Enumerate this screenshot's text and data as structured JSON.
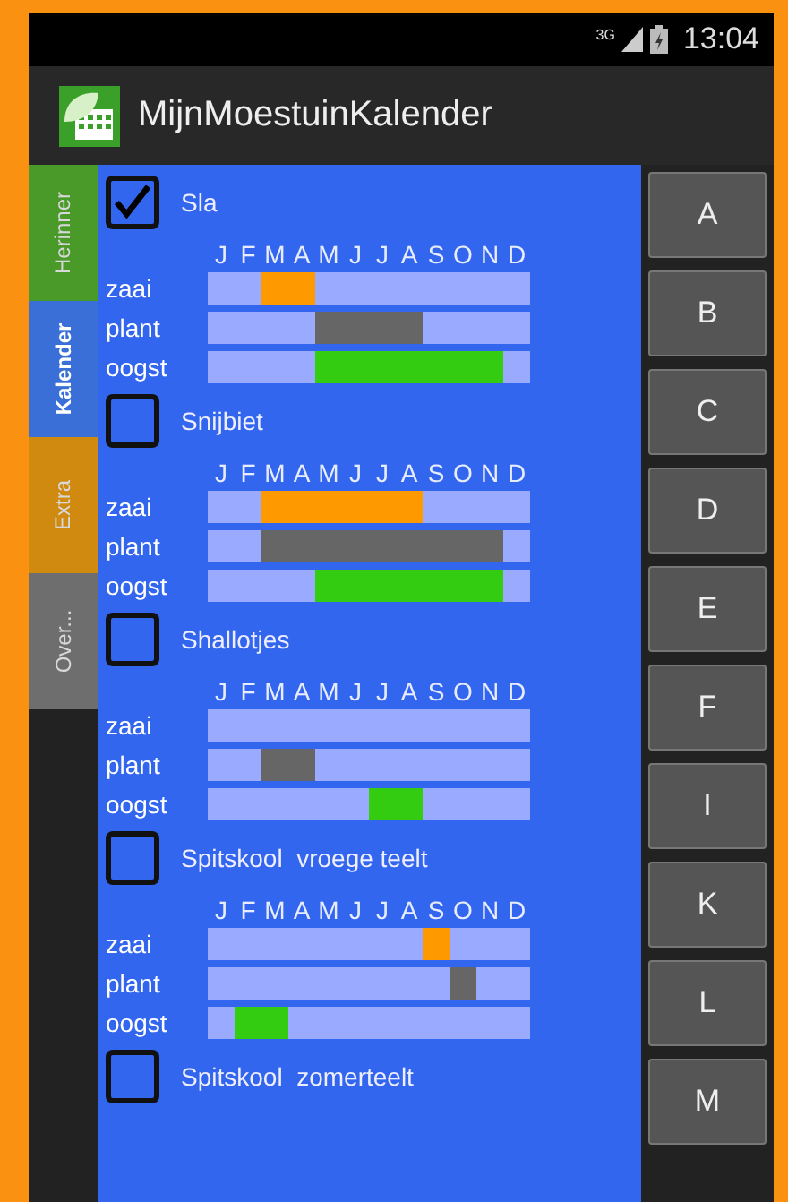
{
  "status_bar": {
    "network": "3G",
    "time": "13:04"
  },
  "app_bar": {
    "title": "MijnMoestuinKalender"
  },
  "side_tabs": [
    {
      "label": "Herinner",
      "selected": false,
      "color": "#4a9a2a"
    },
    {
      "label": "Kalender",
      "selected": true,
      "color": "#3a6fd8"
    },
    {
      "label": "Extra",
      "selected": false,
      "color": "#d08a10"
    },
    {
      "label": "Over...",
      "selected": false,
      "color": "#6e6e6e"
    }
  ],
  "crops": [
    {
      "name": "Sla",
      "checked": true,
      "months": [
        "J",
        "F",
        "M",
        "A",
        "M",
        "J",
        "J",
        "A",
        "S",
        "O",
        "N",
        "D"
      ],
      "rows": [
        {
          "label": "zaai",
          "active": [
            false,
            false,
            true,
            true,
            false,
            false,
            false,
            false,
            false,
            false,
            false,
            false
          ]
        },
        {
          "label": "plant",
          "active": [
            false,
            false,
            false,
            false,
            true,
            true,
            true,
            true,
            false,
            false,
            false,
            false
          ]
        },
        {
          "label": "oogst",
          "active": [
            false,
            false,
            false,
            false,
            true,
            true,
            true,
            true,
            true,
            true,
            true,
            false
          ]
        }
      ]
    },
    {
      "name": "Snijbiet",
      "checked": false,
      "months": [
        "J",
        "F",
        "M",
        "A",
        "M",
        "J",
        "J",
        "A",
        "S",
        "O",
        "N",
        "D"
      ],
      "rows": [
        {
          "label": "zaai",
          "active": [
            false,
            false,
            true,
            true,
            true,
            true,
            true,
            true,
            false,
            false,
            false,
            false
          ]
        },
        {
          "label": "plant",
          "active": [
            false,
            false,
            true,
            true,
            true,
            true,
            true,
            true,
            true,
            true,
            true,
            false
          ]
        },
        {
          "label": "oogst",
          "active": [
            false,
            false,
            false,
            false,
            true,
            true,
            true,
            true,
            true,
            true,
            true,
            false
          ]
        }
      ]
    },
    {
      "name": "Shallotjes",
      "checked": false,
      "months": [
        "J",
        "F",
        "M",
        "A",
        "M",
        "J",
        "J",
        "A",
        "S",
        "O",
        "N",
        "D"
      ],
      "rows": [
        {
          "label": "zaai",
          "active": [
            false,
            false,
            false,
            false,
            false,
            false,
            false,
            false,
            false,
            false,
            false,
            false
          ]
        },
        {
          "label": "plant",
          "active": [
            false,
            false,
            true,
            true,
            false,
            false,
            false,
            false,
            false,
            false,
            false,
            false
          ]
        },
        {
          "label": "oogst",
          "active": [
            false,
            false,
            false,
            false,
            false,
            false,
            true,
            true,
            false,
            false,
            false,
            false
          ]
        }
      ]
    },
    {
      "name": "Spitskool  vroege teelt",
      "checked": false,
      "months": [
        "J",
        "F",
        "M",
        "A",
        "M",
        "J",
        "J",
        "A",
        "S",
        "O",
        "N",
        "D"
      ],
      "rows": [
        {
          "label": "zaai",
          "active": [
            false,
            false,
            false,
            false,
            false,
            false,
            false,
            false,
            true,
            false,
            false,
            false
          ]
        },
        {
          "label": "plant",
          "active": [
            false,
            false,
            false,
            false,
            false,
            false,
            false,
            false,
            false,
            true,
            false,
            false
          ]
        },
        {
          "label": "oogst",
          "active": [
            false,
            true,
            true,
            false,
            false,
            false,
            false,
            false,
            false,
            false,
            false,
            false
          ]
        }
      ]
    },
    {
      "name": "Spitskool  zomerteelt",
      "checked": false
    }
  ],
  "index_buttons": [
    "A",
    "B",
    "C",
    "D",
    "E",
    "F",
    "I",
    "K",
    "L",
    "M"
  ]
}
